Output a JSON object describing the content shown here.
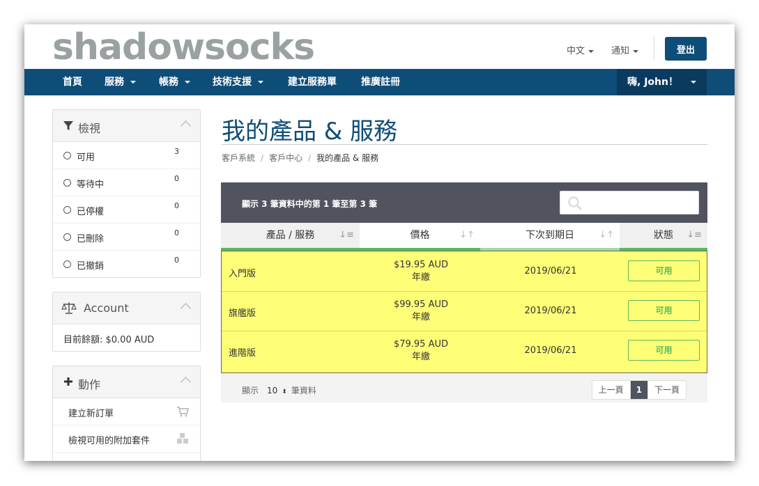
{
  "header": {
    "logo": "shadowsocks",
    "lang": "中文",
    "notify": "通知",
    "logout": "登出"
  },
  "nav": {
    "items": [
      "首頁",
      "服務",
      "帳務",
      "技術支援",
      "建立服務單",
      "推廣註冊"
    ],
    "user": "嗨, John！"
  },
  "sidebar": {
    "view": {
      "title": "檢視",
      "items": [
        {
          "label": "可用",
          "count": "3"
        },
        {
          "label": "等待中",
          "count": "0"
        },
        {
          "label": "已停權",
          "count": "0"
        },
        {
          "label": "已刪除",
          "count": "0"
        },
        {
          "label": "已撤銷",
          "count": "0"
        }
      ]
    },
    "account": {
      "title": "Account",
      "balance": "目前餘額: $0.00 AUD"
    },
    "actions": {
      "title": "動作",
      "items": [
        "建立新訂單",
        "檢視可用的附加套件"
      ]
    }
  },
  "main": {
    "title": "我的產品 & 服務",
    "breadcrumb": [
      "客戶系統",
      "客戶中心",
      "我的產品 & 服務"
    ],
    "table_info": "顯示 3 筆資料中的第 1 筆至第 3 筆",
    "columns": [
      "產品 / 服務",
      "價格",
      "下次到期日",
      "狀態"
    ],
    "rows": [
      {
        "name": "入門版",
        "price": "$19.95 AUD",
        "cycle": "年繳",
        "date": "2019/06/21",
        "status": "可用"
      },
      {
        "name": "旗艦版",
        "price": "$99.95 AUD",
        "cycle": "年繳",
        "date": "2019/06/21",
        "status": "可用"
      },
      {
        "name": "進階版",
        "price": "$79.95 AUD",
        "cycle": "年繳",
        "date": "2019/06/21",
        "status": "可用"
      }
    ],
    "footer": {
      "show_label": "顯示",
      "page_size": "10",
      "records_label": "筆資料",
      "prev": "上一頁",
      "page": "1",
      "next": "下一頁"
    }
  },
  "colors": {
    "brand": "#0e4d78",
    "highlight": "#ffff77",
    "status_green": "#5cb85c"
  }
}
